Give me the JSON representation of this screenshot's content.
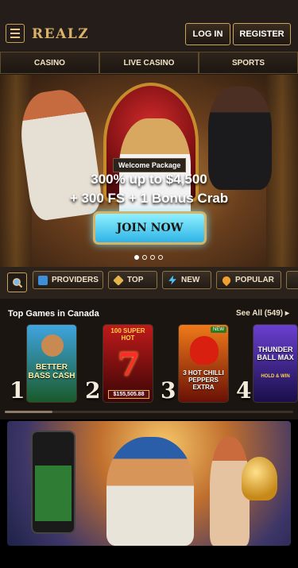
{
  "header": {
    "logo": "REALZ",
    "menu_icon": "hamburger-menu-icon",
    "login_label": "LOG IN",
    "register_label": "REGISTER"
  },
  "nav": {
    "tabs": [
      {
        "label": "CASINO"
      },
      {
        "label": "LIVE CASINO"
      },
      {
        "label": "SPORTS"
      }
    ]
  },
  "hero": {
    "badge": "Welcome Package",
    "offer_line1": "300% up to $4,500",
    "offer_line2": "+ 300 FS + 1 Bonus Crab",
    "cta_label": "JOIN NOW",
    "slides_total": 4,
    "active_slide": 1
  },
  "categories": {
    "search_icon": "search-icon",
    "items": [
      {
        "label": "PROVIDERS",
        "icon": "providers-icon",
        "color": "#3f8fd8"
      },
      {
        "label": "TOP",
        "icon": "top-diamond-icon",
        "color": "#e2b44a"
      },
      {
        "label": "NEW",
        "icon": "lightning-icon",
        "color": "#4fc3f7"
      },
      {
        "label": "POPULAR",
        "icon": "popular-drop-icon",
        "color": "#f0a030"
      }
    ]
  },
  "top_games": {
    "title": "Top Games in Canada",
    "see_all": "See All (549)",
    "games": [
      {
        "rank": "1",
        "title": "BETTER BASS CASH",
        "colors": [
          "#3fa5e0",
          "#1a5a2a"
        ]
      },
      {
        "rank": "2",
        "title": "100 SUPER HOT",
        "jackpot": "$155,505.88",
        "colors": [
          "#c01a1a",
          "#3a0506"
        ]
      },
      {
        "rank": "3",
        "title": "3 HOT CHILLI PEPPERS EXTRA",
        "badge": "NEW",
        "colors": [
          "#f07a1a",
          "#6a1005"
        ]
      },
      {
        "rank": "4",
        "title": "THUNDER BALL MAX",
        "subtitle": "HOLD & WIN",
        "colors": [
          "#6a3fd0",
          "#1a0f4a"
        ]
      }
    ]
  }
}
